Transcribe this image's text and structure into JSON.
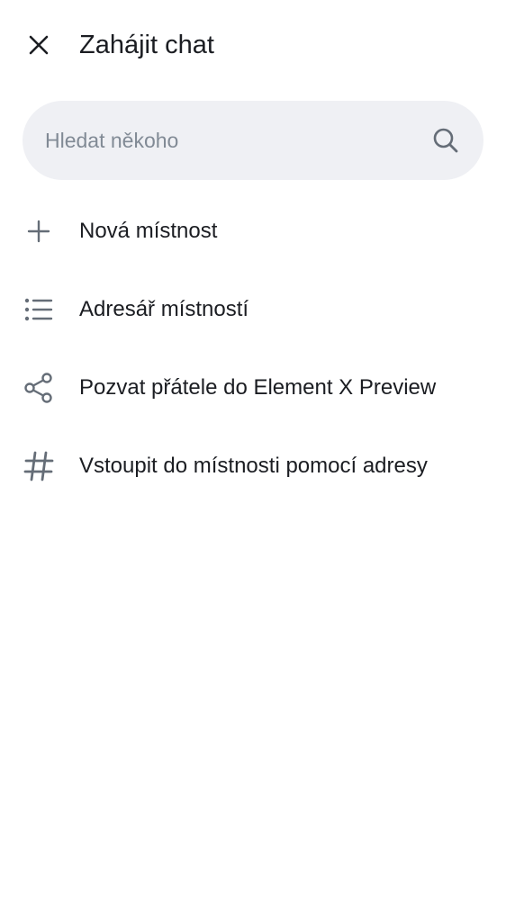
{
  "header": {
    "title": "Zahájit chat",
    "close_icon": "close-icon"
  },
  "search": {
    "placeholder": "Hledat někoho",
    "value": "",
    "icon": "search-icon"
  },
  "menu": {
    "items": [
      {
        "label": "Nová místnost",
        "icon": "plus-icon"
      },
      {
        "label": "Adresář místností",
        "icon": "list-icon"
      },
      {
        "label": "Pozvat přátele do Element X Preview",
        "icon": "share-icon"
      },
      {
        "label": "Vstoupit do místnosti pomocí adresy",
        "icon": "hash-icon"
      }
    ]
  },
  "colors": {
    "background": "#ffffff",
    "text_primary": "#1b1d22",
    "icon": "#656d77",
    "search_bg": "#eff0f4",
    "placeholder": "#818a95"
  }
}
